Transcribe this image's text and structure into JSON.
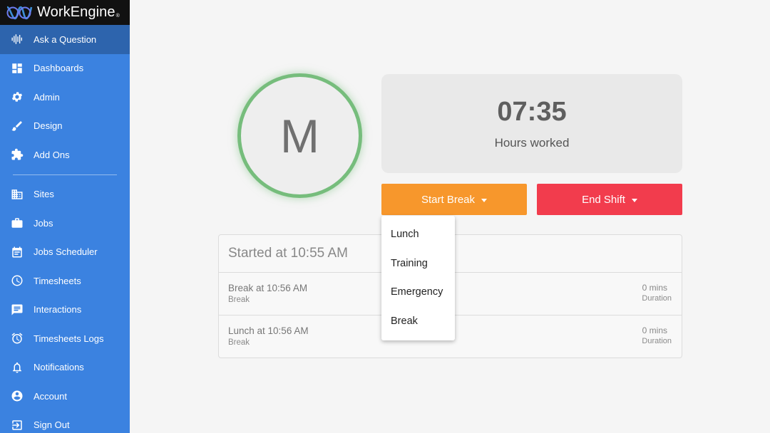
{
  "brand": {
    "name": "WorkEngine",
    "tm": "®"
  },
  "sidebar": {
    "items": [
      {
        "label": "Ask a Question",
        "icon": "voice-wave-icon"
      },
      {
        "label": "Dashboards",
        "icon": "dashboard-icon"
      },
      {
        "label": "Admin",
        "icon": "gear-icon"
      },
      {
        "label": "Design",
        "icon": "brush-icon"
      },
      {
        "label": "Add Ons",
        "icon": "puzzle-icon"
      },
      {
        "label": "Sites",
        "icon": "building-icon"
      },
      {
        "label": "Jobs",
        "icon": "briefcase-icon"
      },
      {
        "label": "Jobs Scheduler",
        "icon": "calendar-icon"
      },
      {
        "label": "Timesheets",
        "icon": "clock-icon"
      },
      {
        "label": "Interactions",
        "icon": "chat-icon"
      },
      {
        "label": "Timesheets Logs",
        "icon": "alarm-icon"
      },
      {
        "label": "Notifications",
        "icon": "bell-icon"
      },
      {
        "label": "Account",
        "icon": "account-icon"
      },
      {
        "label": "Sign Out",
        "icon": "sign-out-icon"
      }
    ]
  },
  "avatar": {
    "initial": "M"
  },
  "timer": {
    "value": "07:35",
    "label": "Hours worked"
  },
  "actions": {
    "start_break": "Start Break",
    "end_shift": "End Shift"
  },
  "break_menu": {
    "options": [
      "Lunch",
      "Training",
      "Emergency",
      "Break"
    ]
  },
  "shift": {
    "title": "Started at 10:55 AM",
    "entries": [
      {
        "title": "Break at 10:56 AM",
        "type": "Break",
        "value": "0 mins",
        "value_label": "Duration"
      },
      {
        "title": "Lunch at 10:56 AM",
        "type": "Break",
        "value": "0 mins",
        "value_label": "Duration"
      }
    ]
  },
  "colors": {
    "sidebar": "#3b82e0",
    "sidebar_active": "#2d64ad",
    "start_break": "#f7972c",
    "end_shift": "#f23c4d",
    "avatar_ring": "#76bd7c"
  }
}
